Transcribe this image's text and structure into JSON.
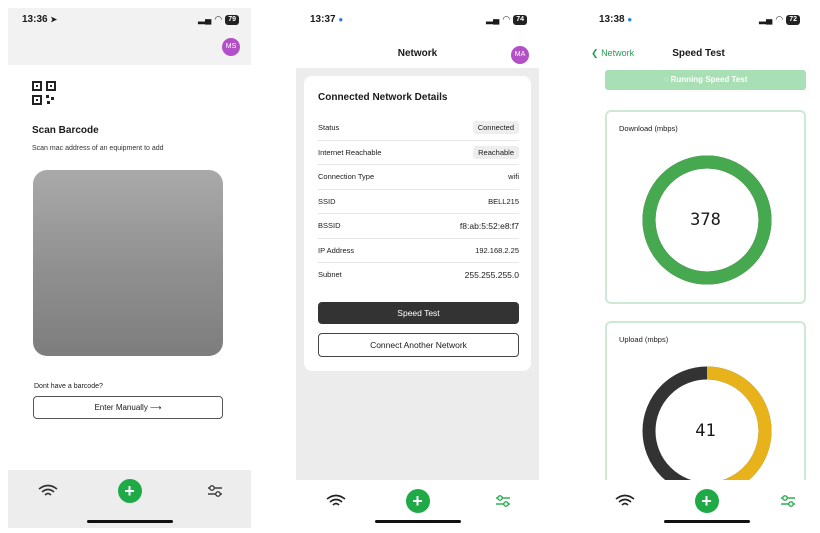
{
  "screen1": {
    "time": "13:36",
    "battery": "79",
    "avatar": "MS",
    "title": "Scan Barcode",
    "subtitle": "Scan mac address of an equipment to add",
    "no_barcode": "Dont have a barcode?",
    "enter_manually": "Enter Manually ⟶"
  },
  "screen2": {
    "time": "13:37",
    "battery": "74",
    "avatar": "MA",
    "nav_title": "Network",
    "card_title": "Connected Network Details",
    "rows": [
      {
        "label": "Status",
        "value": "Connected",
        "pill": true
      },
      {
        "label": "Internet Reachable",
        "value": "Reachable",
        "pill": true
      },
      {
        "label": "Connection Type",
        "value": "wifi",
        "pill": false
      },
      {
        "label": "SSID",
        "value": "BELL215",
        "pill": false
      },
      {
        "label": "BSSID",
        "value": "f8:ab:5:52:e8:f7",
        "pill": false
      },
      {
        "label": "IP Address",
        "value": "192.168.2.25",
        "pill": false
      },
      {
        "label": "Subnet",
        "value": "255.255.255.0",
        "pill": false
      }
    ],
    "speed_test": "Speed Test",
    "connect_another": "Connect Another Network"
  },
  "screen3": {
    "time": "13:38",
    "battery": "72",
    "back_label": "Network",
    "nav_title": "Speed Test",
    "running": "Running Speed Test",
    "download": {
      "label": "Download (mbps)",
      "value": "378",
      "fraction": 1.0,
      "color": "#46a84f"
    },
    "upload": {
      "label": "Upload (mbps)",
      "value": "41",
      "fraction": 0.5,
      "color": "#e7b21a"
    }
  },
  "colors": {
    "accent": "#1faa47",
    "dark_ring": "#333333"
  }
}
